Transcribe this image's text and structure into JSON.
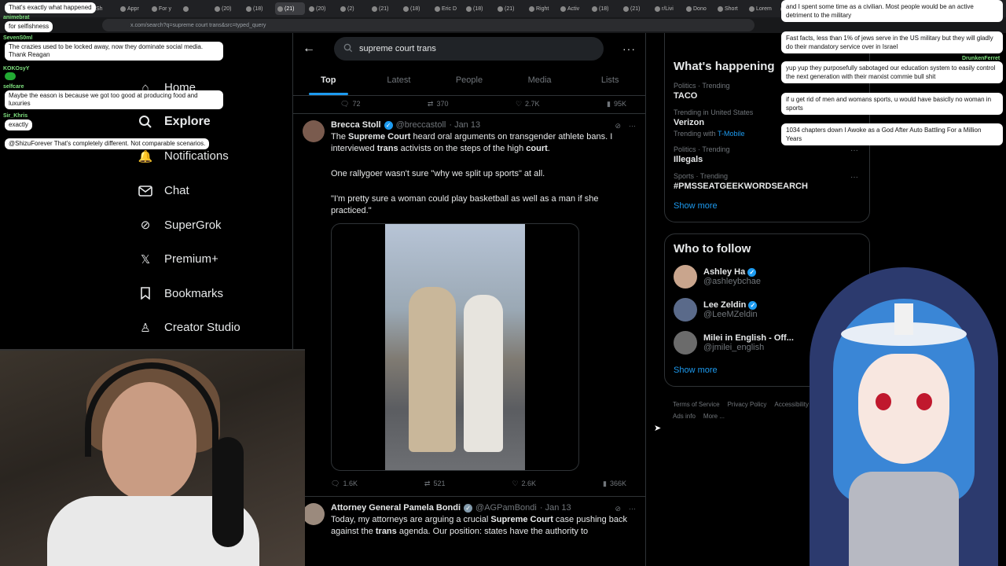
{
  "browser": {
    "tabs": [
      "Sh",
      "Appr",
      "For y",
      "",
      "(20)",
      "(18)",
      "(21)",
      "(20)",
      "(2)",
      "(21)",
      "(18)",
      "Eric D",
      "(18)",
      "(21)",
      "Right",
      "Activ",
      "(18)",
      "(21)",
      "r/Livi",
      "Dono",
      "Short",
      "Lorem",
      "Lorem"
    ],
    "url": "x.com/search?q=supreme court trans&src=typed_query"
  },
  "nav": {
    "home": "Home",
    "explore": "Explore",
    "notifications": "Notifications",
    "chat": "Chat",
    "supergrok": "SuperGrok",
    "premium": "Premium+",
    "bookmarks": "Bookmarks",
    "creator_studio": "Creator Studio"
  },
  "search": {
    "query": "supreme court trans",
    "tabs": [
      "Top",
      "Latest",
      "People",
      "Media",
      "Lists"
    ],
    "active_tab": "Top"
  },
  "tweets": [
    {
      "stats": {
        "replies": "72",
        "reposts": "370",
        "likes": "2.7K",
        "views": "95K"
      }
    },
    {
      "name": "Brecca Stoll",
      "handle": "@breccastoll",
      "date": "· Jan 13",
      "p1_a": "The ",
      "p1_b": "Supreme Court",
      "p1_c": " heard oral arguments on transgender athlete bans. I interviewed ",
      "p1_d": "trans",
      "p1_e": " activists on the steps of the high ",
      "p1_f": "court",
      "p1_g": ".",
      "p2": "One rallygoer wasn't sure \"why we split up sports\" at all.",
      "p3": "\"I'm pretty sure a woman could play basketball as well as a man if she practiced.\"",
      "stats": {
        "replies": "1.6K",
        "reposts": "521",
        "likes": "2.6K",
        "views": "366K"
      }
    },
    {
      "name": "Attorney General Pamela Bondi",
      "handle": "@AGPamBondi",
      "date": "· Jan 13",
      "p1_a": "Today, my attorneys are arguing a crucial ",
      "p1_b": "Supreme Court",
      "p1_c": " case pushing back against the ",
      "p1_d": "trans",
      "p1_e": " agenda. Our position: states have the authority to"
    }
  ],
  "happening": {
    "title": "What's happening",
    "trends": [
      {
        "category": "Politics · Trending",
        "name": "TACO",
        "with": "",
        "with_link": ""
      },
      {
        "category": "Trending in United States",
        "name": "Verizon",
        "with": "Trending with ",
        "with_link": "T-Mobile"
      },
      {
        "category": "Politics · Trending",
        "name": "Illegals",
        "with": "",
        "with_link": ""
      },
      {
        "category": "Sports · Trending",
        "name": "#PMSSEATGEEKWORDSEARCH",
        "with": "",
        "with_link": ""
      }
    ],
    "show_more": "Show more"
  },
  "who_to_follow": {
    "title": "Who to follow",
    "accounts": [
      {
        "name": "Ashley Ha",
        "handle": "@ashleybchae"
      },
      {
        "name": "Lee Zeldin",
        "handle": "@LeeMZeldin"
      },
      {
        "name": "Milei in English - Off...",
        "handle": "@jmilei_english"
      }
    ],
    "show_more": "Show more"
  },
  "footer": [
    "Terms of Service",
    "Privacy Policy",
    "Accessibility",
    "Ads info",
    "More ..."
  ],
  "chat_left": [
    {
      "user": "",
      "text": "That's exactly what happened"
    },
    {
      "user": "animebrat",
      "text": "for selfishness"
    },
    {
      "user": "SevenS0ml",
      "text": "The crazies used to be locked away, now they dominate social media. Thank Reagan"
    },
    {
      "user": "KOKOsyY",
      "text": ""
    },
    {
      "user": "selfcare",
      "text": "Maybe the eason is because we got too good at producing food and luxuries"
    },
    {
      "user": "Sir_Khris",
      "text": "exactly"
    },
    {
      "user": "",
      "text": "@ShizuForever That's completely different. Not comparable scenarios."
    }
  ],
  "chat_right": [
    {
      "user": "",
      "text": "and I spent some time as a civilian. Most people would be an active detriment to the military"
    },
    {
      "user": "",
      "text": "Fast facts, less than 1% of jews serve in the US military but they will gladly do their mandatory service over in Israel"
    },
    {
      "user": "DrunkenFerret",
      "text": "yup yup they purposefully sabotaged our education system to easily control the next generation with their marxist commie bull shit"
    },
    {
      "user": "",
      "text": "if u get rid of men and womans sports, u would have basiclly no woman in sports"
    },
    {
      "user": "",
      "text": "1034 chapters down  I Awoke as a God After Auto Battling For a Million Years"
    }
  ]
}
